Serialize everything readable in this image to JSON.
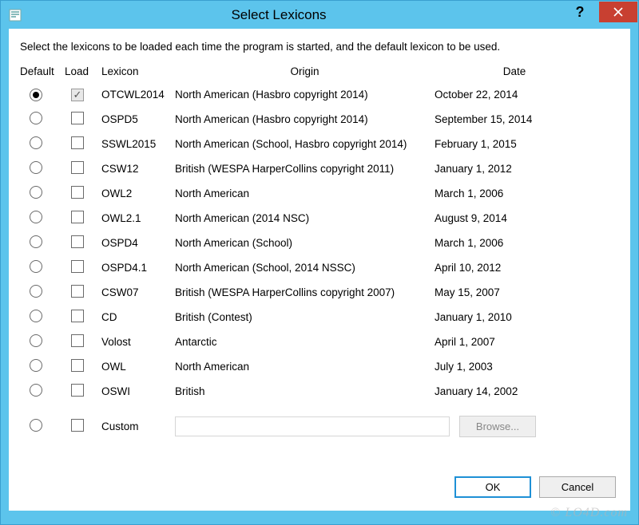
{
  "window": {
    "title": "Select Lexicons",
    "help_tooltip": "?",
    "close_tooltip": "Close"
  },
  "instructions": "Select the lexicons to be loaded each time the program is started, and the default lexicon to be used.",
  "headers": {
    "default": "Default",
    "load": "Load",
    "lexicon": "Lexicon",
    "origin": "Origin",
    "date": "Date"
  },
  "rows": [
    {
      "default": true,
      "load": true,
      "lexicon": "OTCWL2014",
      "origin": "North American (Hasbro copyright 2014)",
      "date": "October 22, 2014"
    },
    {
      "default": false,
      "load": false,
      "lexicon": "OSPD5",
      "origin": "North American (Hasbro copyright 2014)",
      "date": "September 15, 2014"
    },
    {
      "default": false,
      "load": false,
      "lexicon": "SSWL2015",
      "origin": "North American (School, Hasbro copyright 2014)",
      "date": "February 1, 2015"
    },
    {
      "default": false,
      "load": false,
      "lexicon": "CSW12",
      "origin": "British (WESPA HarperCollins copyright 2011)",
      "date": "January 1, 2012"
    },
    {
      "default": false,
      "load": false,
      "lexicon": "OWL2",
      "origin": "North American",
      "date": "March 1, 2006"
    },
    {
      "default": false,
      "load": false,
      "lexicon": "OWL2.1",
      "origin": "North American (2014 NSC)",
      "date": "August 9, 2014"
    },
    {
      "default": false,
      "load": false,
      "lexicon": "OSPD4",
      "origin": "North American (School)",
      "date": "March 1, 2006"
    },
    {
      "default": false,
      "load": false,
      "lexicon": "OSPD4.1",
      "origin": "North American (School, 2014 NSSC)",
      "date": "April 10, 2012"
    },
    {
      "default": false,
      "load": false,
      "lexicon": "CSW07",
      "origin": "British (WESPA HarperCollins copyright 2007)",
      "date": "May 15, 2007"
    },
    {
      "default": false,
      "load": false,
      "lexicon": "CD",
      "origin": "British (Contest)",
      "date": "January 1, 2010"
    },
    {
      "default": false,
      "load": false,
      "lexicon": "Volost",
      "origin": "Antarctic",
      "date": "April 1, 2007"
    },
    {
      "default": false,
      "load": false,
      "lexicon": "OWL",
      "origin": "North American",
      "date": "July 1, 2003"
    },
    {
      "default": false,
      "load": false,
      "lexicon": "OSWI",
      "origin": "British",
      "date": "January 14, 2002"
    }
  ],
  "custom": {
    "label": "Custom",
    "path": "",
    "browse": "Browse..."
  },
  "buttons": {
    "ok": "OK",
    "cancel": "Cancel"
  },
  "watermark": "© LO4D.com"
}
